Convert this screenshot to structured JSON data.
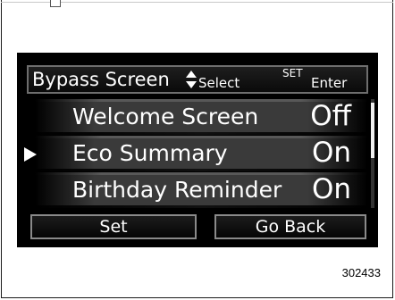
{
  "header": {
    "title": "Bypass Screen",
    "select_hint": "Select",
    "set_hint": "SET",
    "enter_hint": "Enter"
  },
  "menu": {
    "items": [
      {
        "label": "Welcome Screen",
        "value": "Off",
        "selected": false
      },
      {
        "label": "Eco Summary",
        "value": "On",
        "selected": true
      },
      {
        "label": "Birthday Reminder",
        "value": "On",
        "selected": false
      }
    ]
  },
  "buttons": {
    "set": "Set",
    "back": "Go Back"
  },
  "figure": {
    "reference_number": "302433"
  },
  "icons": [
    "up-down-arrows-icon",
    "cursor-arrow-icon",
    "manual-icon"
  ]
}
